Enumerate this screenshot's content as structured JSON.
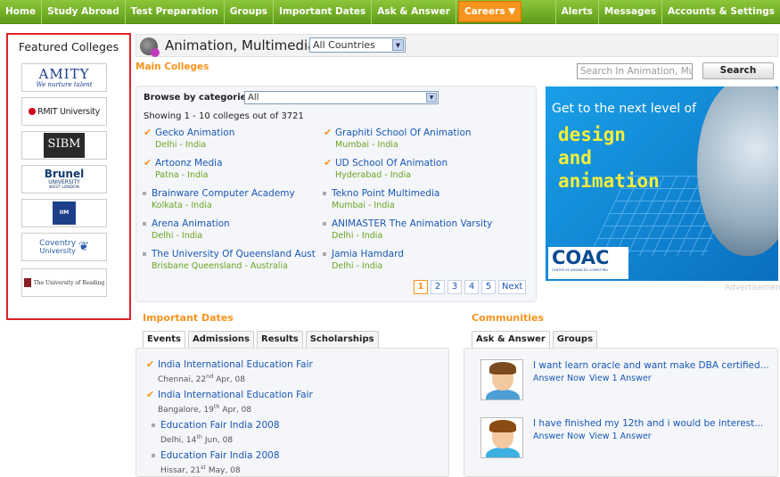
{
  "topnav": {
    "left": [
      "Home",
      "Study Abroad",
      "Test Preparation",
      "Groups",
      "Important Dates",
      "Ask & Answer"
    ],
    "careers": "Careers ▼",
    "right": [
      "Alerts",
      "Messages",
      "Accounts & Settings"
    ]
  },
  "featured": {
    "title": "Featured Colleges",
    "logos": [
      {
        "name": "AMITY",
        "tagline": "We nurture talent"
      },
      {
        "name": "RMIT University"
      },
      {
        "name": "SIBM"
      },
      {
        "name": "Brunel",
        "sub": "UNIVERSITY",
        "sub2": "WEST LONDON"
      },
      {
        "name": "IIM"
      },
      {
        "name": "Coventry",
        "sub": "University"
      },
      {
        "name": "The University of Reading"
      }
    ]
  },
  "header": {
    "title": "Animation, Multimedia",
    "country_select": "All Countries"
  },
  "main": {
    "section_title": "Main Colleges",
    "search_placeholder": "Search In Animation, Mu",
    "search_button": "Search",
    "browse_label": "Browse by categories:",
    "category_select": "All",
    "showing": "Showing 1 - 10 colleges out of 3721",
    "colleges": [
      {
        "name": "Gecko Animation",
        "loc": "Delhi - India",
        "featured": true
      },
      {
        "name": "Graphiti School Of Animation",
        "loc": "Mumbai - India",
        "featured": true
      },
      {
        "name": "Artoonz Media",
        "loc": "Patna - India",
        "featured": true
      },
      {
        "name": "UD School Of Animation",
        "loc": "Hyderabad - India",
        "featured": true
      },
      {
        "name": "Brainware Computer Academy",
        "loc": "Kolkata - India",
        "featured": false
      },
      {
        "name": "Tekno Point Multimedia",
        "loc": "Mumbai - India",
        "featured": false
      },
      {
        "name": "Arena Animation",
        "loc": "Delhi - India",
        "featured": false
      },
      {
        "name": "ANIMASTER The Animation Varsity",
        "loc": "Delhi - India",
        "featured": false
      },
      {
        "name": "The University Of Queensland Aust",
        "loc": "Brisbane Queensland - Australia",
        "featured": false
      },
      {
        "name": "Jamia Hamdard",
        "loc": "Delhi - India",
        "featured": false
      }
    ],
    "pager": [
      "1",
      "2",
      "3",
      "4",
      "5",
      "Next"
    ]
  },
  "ad": {
    "line1": "Get to the next level of",
    "line2": "design",
    "line3": "and",
    "line4": "animation",
    "brand": "COAC",
    "brand_sub": "CENTER OF ADVANCED COMPUTING",
    "label": "Advertisement"
  },
  "dates": {
    "title": "Important Dates",
    "tabs": [
      "Events",
      "Admissions",
      "Results",
      "Scholarships"
    ],
    "events": [
      {
        "name": "India International Education Fair",
        "city": "Chennai, 22",
        "ord": "nd",
        "rest": " Apr, 08",
        "featured": true
      },
      {
        "name": "India International Education Fair",
        "city": "Bangalore, 19",
        "ord": "th",
        "rest": " Apr, 08",
        "featured": true
      },
      {
        "name": "Education Fair India 2008",
        "city": "Delhi, 14",
        "ord": "th",
        "rest": " Jun, 08",
        "featured": false
      },
      {
        "name": "Education Fair India 2008",
        "city": "Hissar, 21",
        "ord": "st",
        "rest": " May, 08",
        "featured": false
      }
    ]
  },
  "communities": {
    "title": "Communities",
    "tabs": [
      "Ask & Answer",
      "Groups"
    ],
    "items": [
      {
        "question": "I want learn oracle and want make DBA certified...",
        "answer_now": "Answer Now",
        "view": "View 1 Answer"
      },
      {
        "question": "I have finished my 12th and i would be interest...",
        "answer_now": "Answer Now",
        "view": "View 1 Answer"
      }
    ]
  }
}
